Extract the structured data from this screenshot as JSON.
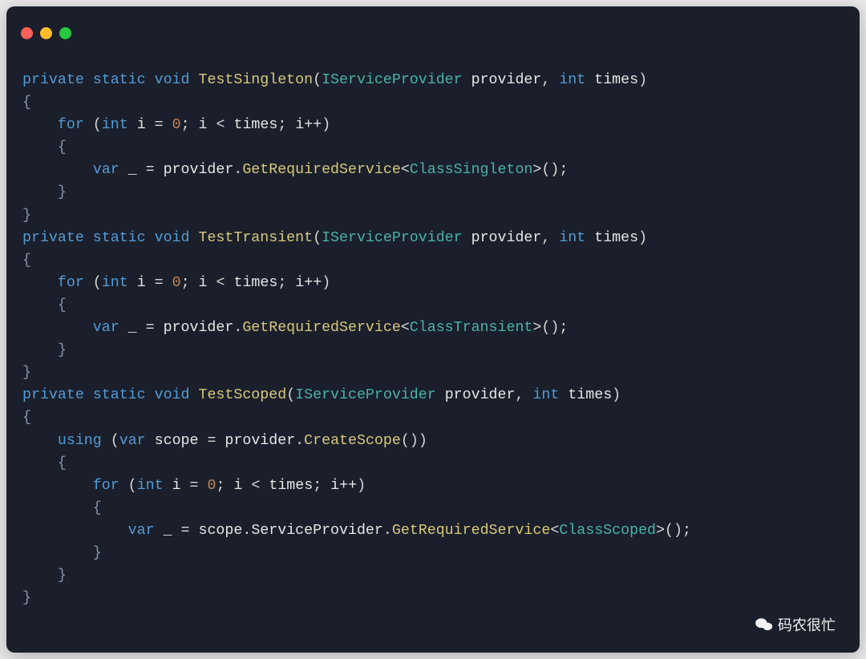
{
  "window": {
    "traffic_lights": [
      "red",
      "yellow",
      "green"
    ]
  },
  "theme": {
    "background": "#1a1f2b",
    "keyword": "#559bd4",
    "function": "#d9c97a",
    "type": "#4ab3a8",
    "number": "#c0855b",
    "text": "#e6e6e6"
  },
  "language": "csharp",
  "code": {
    "methods": [
      {
        "name": "TestSingleton",
        "signature": "private static void TestSingleton(IServiceProvider provider, int times)",
        "body": [
          "{",
          "    for (int i = 0; i < times; i++)",
          "    {",
          "        var _ = provider.GetRequiredService<ClassSingleton>();",
          "    }",
          "}"
        ],
        "service_class": "ClassSingleton"
      },
      {
        "name": "TestTransient",
        "signature": "private static void TestTransient(IServiceProvider provider, int times)",
        "body": [
          "{",
          "    for (int i = 0; i < times; i++)",
          "    {",
          "        var _ = provider.GetRequiredService<ClassTransient>();",
          "    }",
          "}"
        ],
        "service_class": "ClassTransient"
      },
      {
        "name": "TestScoped",
        "signature": "private static void TestScoped(IServiceProvider provider, int times)",
        "body": [
          "{",
          "    using (var scope = provider.CreateScope())",
          "    {",
          "        for (int i = 0; i < times; i++)",
          "        {",
          "            var _ = scope.ServiceProvider.GetRequiredService<ClassScoped>();",
          "        }",
          "    }",
          "}"
        ],
        "service_class": "ClassScoped"
      }
    ],
    "tokens": {
      "kw_private": "private",
      "kw_static": "static",
      "kw_void": "void",
      "kw_for": "for",
      "kw_int": "int",
      "kw_var": "var",
      "kw_using": "using",
      "fn_TestSingleton": "TestSingleton",
      "fn_TestTransient": "TestTransient",
      "fn_TestScoped": "TestScoped",
      "fn_GetRequiredService": "GetRequiredService",
      "fn_CreateScope": "CreateScope",
      "type_IServiceProvider": "IServiceProvider",
      "type_ClassSingleton": "ClassSingleton",
      "type_ClassTransient": "ClassTransient",
      "type_ClassScoped": "ClassScoped",
      "id_provider": "provider",
      "id_times": "times",
      "id_i": "i",
      "id_scope": "scope",
      "id_ServiceProvider": "ServiceProvider",
      "id_underscore": "_",
      "num_zero": "0",
      "p_lparen": "(",
      "p_rparen": ")",
      "p_lbrace": "{",
      "p_rbrace": "}",
      "p_lt": "<",
      "p_gt": ">",
      "p_comma_sp": ", ",
      "p_semicolon": ";",
      "p_semicolon_sp": "; ",
      "p_eq": " = ",
      "p_dot": ".",
      "p_ipp": "i++",
      "p_space": " ",
      "p_parens_semi": "();"
    }
  },
  "watermark": {
    "icon": "wechat",
    "text": "码农很忙"
  }
}
